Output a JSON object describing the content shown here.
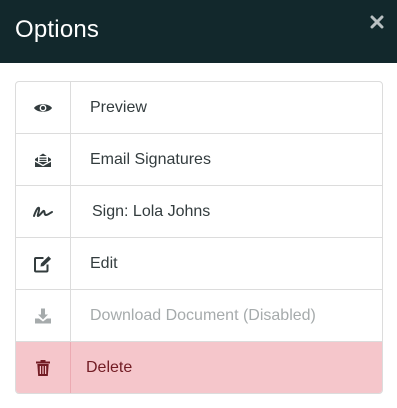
{
  "modal": {
    "title": "Options",
    "close_icon": "close-icon"
  },
  "options": [
    {
      "label": "Preview",
      "icon": "eye-icon",
      "state": "enabled"
    },
    {
      "label": "Email Signatures",
      "icon": "envelope-open-icon",
      "state": "enabled"
    },
    {
      "label": "Sign: Lola Johns",
      "icon": "signature-icon",
      "state": "enabled"
    },
    {
      "label": "Edit",
      "icon": "edit-icon",
      "state": "enabled"
    },
    {
      "label": "Download Document (Disabled)",
      "icon": "download-icon",
      "state": "disabled"
    },
    {
      "label": "Delete",
      "icon": "trash-icon",
      "state": "danger"
    }
  ],
  "colors": {
    "header_bg": "#12282c",
    "icon": "#333c3e",
    "disabled": "#a6abac",
    "danger_bg": "#f5c6cb",
    "danger_text": "#721c24",
    "border": "#dcdcdc"
  }
}
